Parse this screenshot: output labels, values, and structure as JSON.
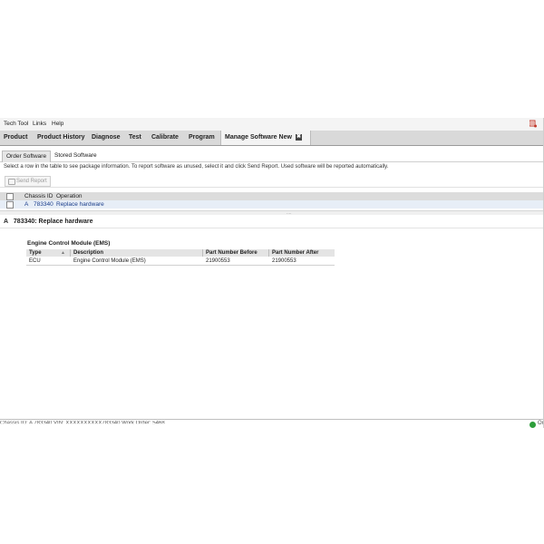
{
  "menu": [
    "Tech Tool",
    "Links",
    "Help"
  ],
  "tabs": [
    "Product",
    "Product History",
    "Diagnose",
    "Test",
    "Calibrate",
    "Program",
    "Manage Software New"
  ],
  "close_symbol": "✖",
  "subtabs": [
    "Order Software",
    "Stored Software"
  ],
  "instructions": "Select a row in the table to see package information. To report software as unused, select it and click Send Report. Used software will be reported automatically.",
  "toolbar": {
    "send_report": "Send Report"
  },
  "grid": {
    "headers": {
      "chassis_id": "Chassis ID",
      "operation": "Operation"
    },
    "row": {
      "prefix": "A",
      "chassis": "783340",
      "operation": "Replace hardware"
    }
  },
  "splitter_grip": "....",
  "detail": {
    "prefix": "A",
    "title": "783340: Replace hardware",
    "module_title": "Engine Control Module (EMS)",
    "headers": {
      "type": "Type",
      "description": "Description",
      "pn_before": "Part Number Before",
      "pn_after": "Part Number After"
    },
    "row": {
      "type": "ECU",
      "description": "Engine Control Module (EMS)",
      "pn_before": "21900553",
      "pn_after": "21900553"
    }
  },
  "status": {
    "text": "Chassis ID: A 783340     VIN: XXXXXXXXXX783340     Work Order: 5468",
    "label": "On"
  },
  "colors": {
    "accent": "#1c3f8c",
    "tabbar": "#d9d9d9",
    "status_ok": "#2e9e3b"
  }
}
